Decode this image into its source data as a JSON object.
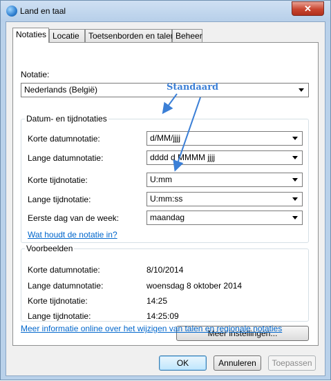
{
  "window": {
    "title": "Land en taal",
    "close_glyph": "✕"
  },
  "tabs": [
    {
      "label": "Notaties",
      "active": true
    },
    {
      "label": "Locatie"
    },
    {
      "label": "Toetsenborden en talen"
    },
    {
      "label": "Beheer"
    }
  ],
  "format": {
    "label": "Notatie:",
    "value": "Nederlands (België)"
  },
  "date_time": {
    "title": "Datum- en tijdnotaties",
    "short_date": {
      "label": "Korte datumnotatie:",
      "value": "d/MM/jjjj"
    },
    "long_date": {
      "label": "Lange datumnotatie:",
      "value": "dddd d MMMM jjjj"
    },
    "short_time": {
      "label": "Korte tijdnotatie:",
      "value": "U:mm"
    },
    "long_time": {
      "label": "Lange tijdnotatie:",
      "value": "U:mm:ss"
    },
    "first_day": {
      "label": "Eerste dag van de week:",
      "value": "maandag"
    },
    "link": "Wat houdt de notatie in?"
  },
  "examples": {
    "title": "Voorbeelden",
    "rows": [
      {
        "label": "Korte datumnotatie:",
        "value": "8/10/2014"
      },
      {
        "label": "Lange datumnotatie:",
        "value": "woensdag 8 oktober 2014"
      },
      {
        "label": "Korte tijdnotatie:",
        "value": "14:25"
      },
      {
        "label": "Lange tijdnotatie:",
        "value": "14:25:09"
      }
    ]
  },
  "more_settings_label": "Meer instellingen...",
  "info_link": "Meer informatie online over het wijzigen van talen en regionale notaties",
  "buttons": {
    "ok": "OK",
    "cancel": "Annuleren",
    "apply": "Toepassen"
  },
  "annotation": {
    "text": "Standaard",
    "color": "#3b7fd6"
  }
}
